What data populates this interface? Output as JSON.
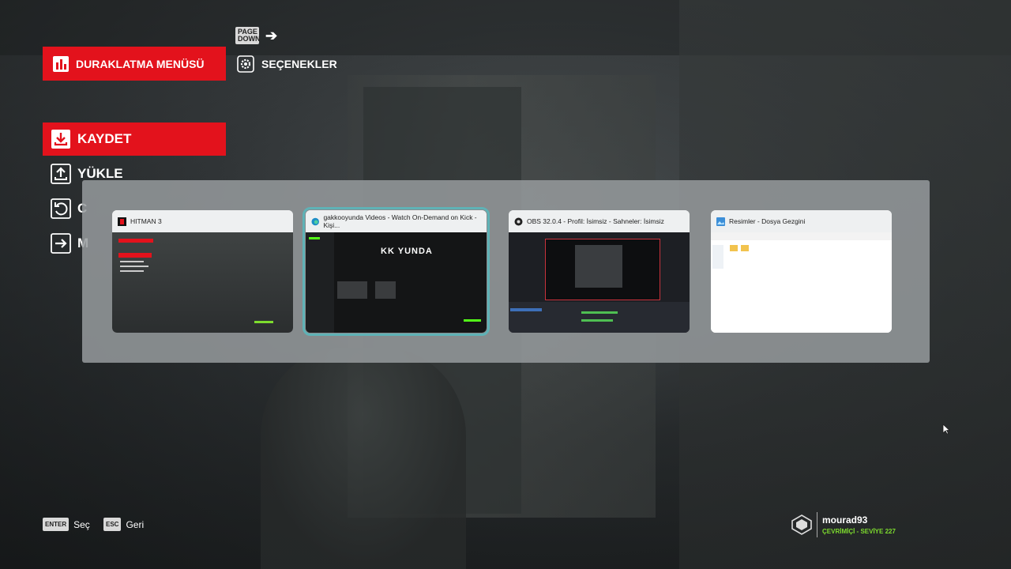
{
  "hints": {
    "page_down_key": "PAGE DOWN",
    "enter_key": "ENTER",
    "enter_label": "Seç",
    "esc_key": "ESC",
    "esc_label": "Geri"
  },
  "tabs": {
    "pause_menu": "DURAKLATMA MENÜSÜ",
    "options": "SEÇENEKLER"
  },
  "menu": {
    "items": [
      {
        "label": "KAYDET",
        "icon": "save-icon",
        "active": true
      },
      {
        "label": "YÜKLE",
        "icon": "upload-icon",
        "active": false
      },
      {
        "label": "C",
        "icon": "restart-icon",
        "active": false
      },
      {
        "label": "M",
        "icon": "exit-icon",
        "active": false
      }
    ]
  },
  "switcher": {
    "windows": [
      {
        "title": "HITMAN 3",
        "icon": "hitman-app-icon",
        "selected": false
      },
      {
        "title": "gakkooyunda Videos - Watch On-Demand on Kick - Kişi...",
        "icon": "edge-browser-icon",
        "selected": true,
        "logo_text": "KK  YUNDA"
      },
      {
        "title": "OBS 32.0.4 - Profil: İsimsiz - Sahneler: İsimsiz",
        "icon": "obs-icon",
        "selected": false
      },
      {
        "title": "Resimler - Dosya Gezgini",
        "icon": "photos-folder-icon",
        "selected": false
      }
    ]
  },
  "profile": {
    "username": "mourad93",
    "status": "ÇEVRİMİÇİ - SEVİYE 227"
  },
  "colors": {
    "accent_red": "#e3121c",
    "online_green": "#7ddc2e",
    "selection_outline": "#5fb2b6"
  }
}
